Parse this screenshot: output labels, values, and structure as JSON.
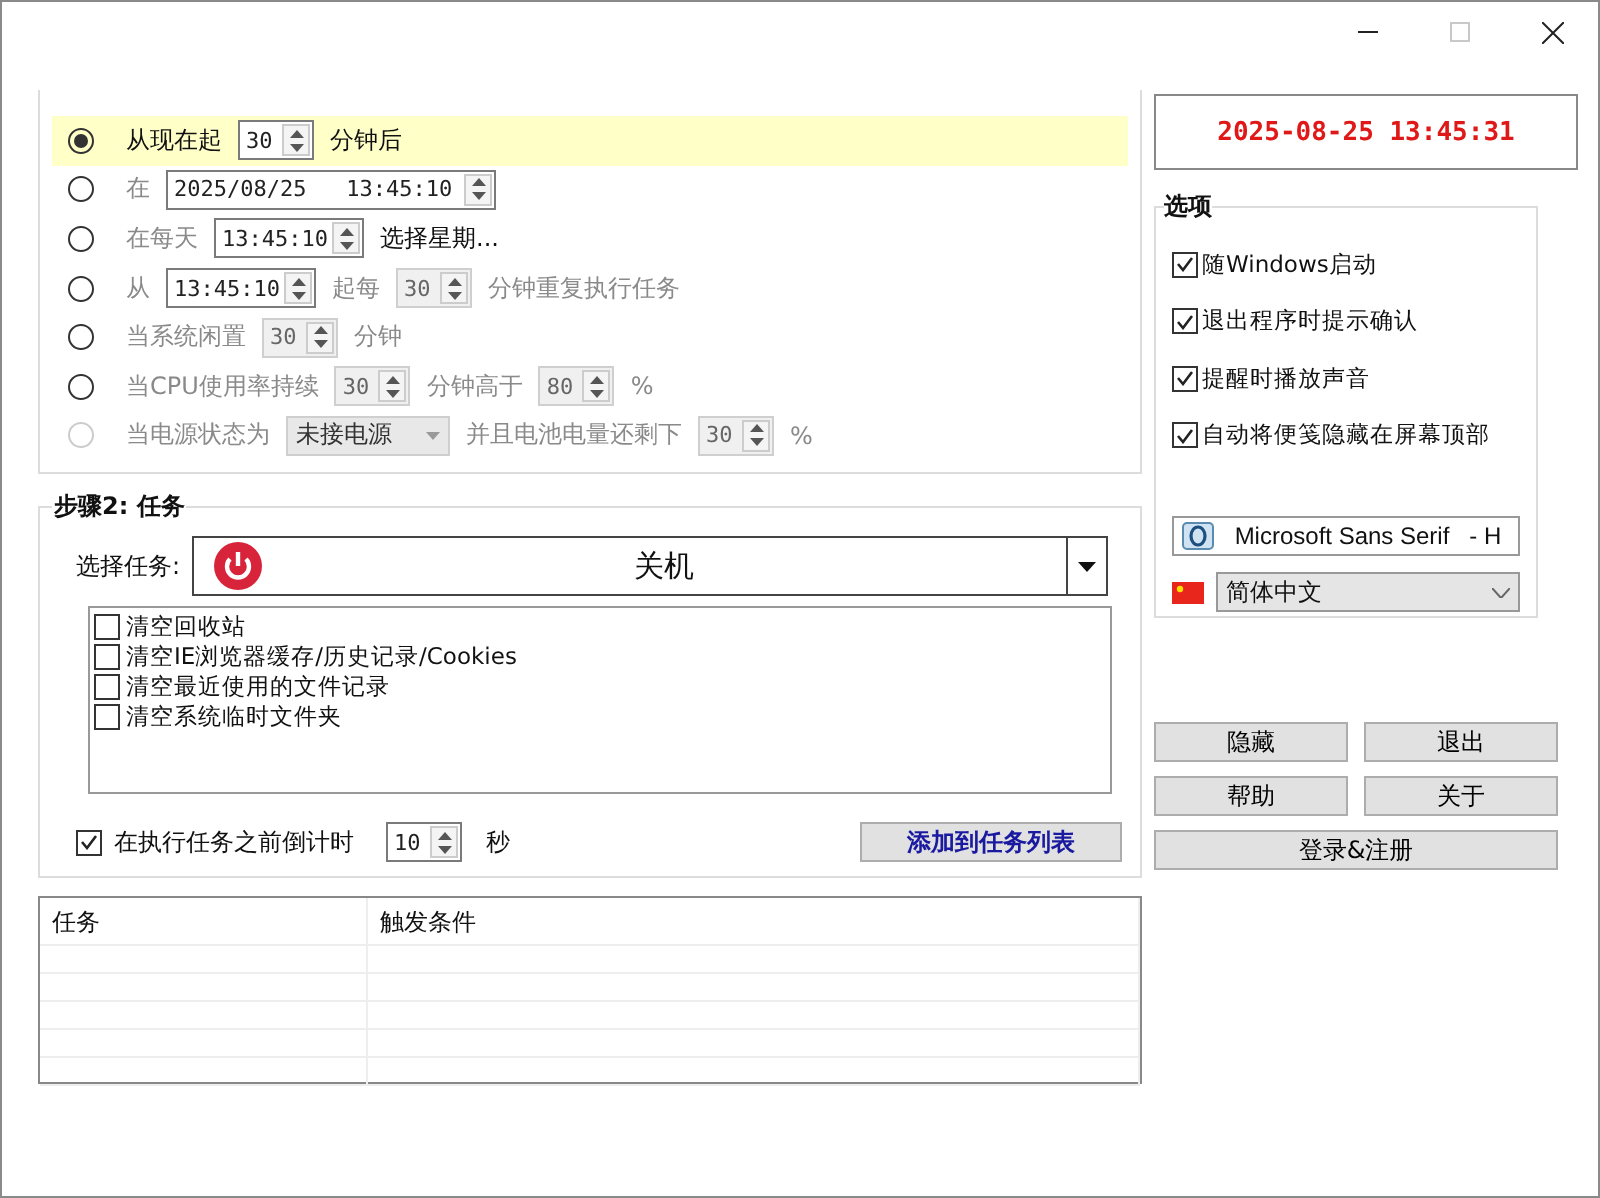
{
  "window_controls": [
    {
      "kind": "minimize",
      "disabled": false
    },
    {
      "kind": "maximize",
      "disabled": true
    },
    {
      "kind": "close",
      "disabled": false
    }
  ],
  "trigger_options": [
    {
      "selected": true,
      "disabled": false,
      "parts": [
        {
          "kind": "label",
          "text": "从现在起"
        },
        {
          "kind": "spin",
          "value": "30",
          "disabled": false
        },
        {
          "kind": "label",
          "text": "分钟后"
        }
      ]
    },
    {
      "selected": false,
      "disabled": false,
      "parts": [
        {
          "kind": "label",
          "text": "在"
        },
        {
          "kind": "date_spin",
          "value": "2025/08/25   13:45:10",
          "disabled": false
        }
      ]
    },
    {
      "selected": false,
      "disabled": false,
      "parts": [
        {
          "kind": "label",
          "text": "在每天"
        },
        {
          "kind": "time_spin",
          "value": "13:45:10",
          "disabled": false
        },
        {
          "kind": "link",
          "text": "选择星期..."
        }
      ]
    },
    {
      "selected": false,
      "disabled": false,
      "parts": [
        {
          "kind": "label",
          "text": "从"
        },
        {
          "kind": "time_spin",
          "value": "13:45:10",
          "disabled": false
        },
        {
          "kind": "label",
          "text": "起每"
        },
        {
          "kind": "spin",
          "value": "30",
          "disabled": true
        },
        {
          "kind": "label",
          "text": "分钟重复执行任务"
        }
      ]
    },
    {
      "selected": false,
      "disabled": false,
      "parts": [
        {
          "kind": "label",
          "text": "当系统闲置"
        },
        {
          "kind": "spin",
          "value": "30",
          "disabled": true
        },
        {
          "kind": "label",
          "text": "分钟"
        }
      ]
    },
    {
      "selected": false,
      "disabled": false,
      "parts": [
        {
          "kind": "label",
          "text": "当CPU使用率持续"
        },
        {
          "kind": "spin",
          "value": "30",
          "disabled": true
        },
        {
          "kind": "label",
          "text": "分钟高于"
        },
        {
          "kind": "spin",
          "value": "80",
          "disabled": true
        },
        {
          "kind": "label",
          "text": "%"
        }
      ]
    },
    {
      "selected": false,
      "disabled": true,
      "parts": [
        {
          "kind": "label",
          "text": "当电源状态为"
        },
        {
          "kind": "combo",
          "value": "未接电源",
          "disabled": true
        },
        {
          "kind": "label",
          "text": "并且电池电量还剩下"
        },
        {
          "kind": "spin",
          "value": "30",
          "disabled": true
        },
        {
          "kind": "label",
          "text": "%"
        }
      ]
    }
  ],
  "clock": "2025-08-25 13:45:31",
  "options": {
    "title": "选项",
    "items": [
      {
        "label": "随Windows启动",
        "checked": true
      },
      {
        "label": "退出程序时提示确认",
        "checked": true
      },
      {
        "label": "提醒时播放声音",
        "checked": true
      },
      {
        "label": "自动将便笺隐藏在屏幕顶部",
        "checked": true
      }
    ],
    "font_combo": "Microsoft Sans Serif   - H",
    "language_combo": "简体中文"
  },
  "buttons": [
    {
      "label": "隐藏",
      "wide": false
    },
    {
      "label": "退出",
      "wide": false
    },
    {
      "label": "帮助",
      "wide": false
    },
    {
      "label": "关于",
      "wide": false
    },
    {
      "label": "登录&注册",
      "wide": true
    }
  ],
  "task": {
    "title": "步骤2: 任务",
    "select_label": "选择任务:",
    "selected_task": "关机",
    "cleanup_items": [
      {
        "label": "清空回收站",
        "checked": false
      },
      {
        "label": "清空IE浏览器缓存/历史记录/Cookies",
        "checked": false
      },
      {
        "label": "清空最近使用的文件记录",
        "checked": false
      },
      {
        "label": "清空系统临时文件夹",
        "checked": false
      }
    ],
    "countdown": {
      "label": "在执行任务之前倒计时",
      "checked": true,
      "value": "10",
      "unit": "秒"
    },
    "add_button": "添加到任务列表"
  },
  "task_table": {
    "columns": [
      "任务",
      "触发条件"
    ]
  }
}
